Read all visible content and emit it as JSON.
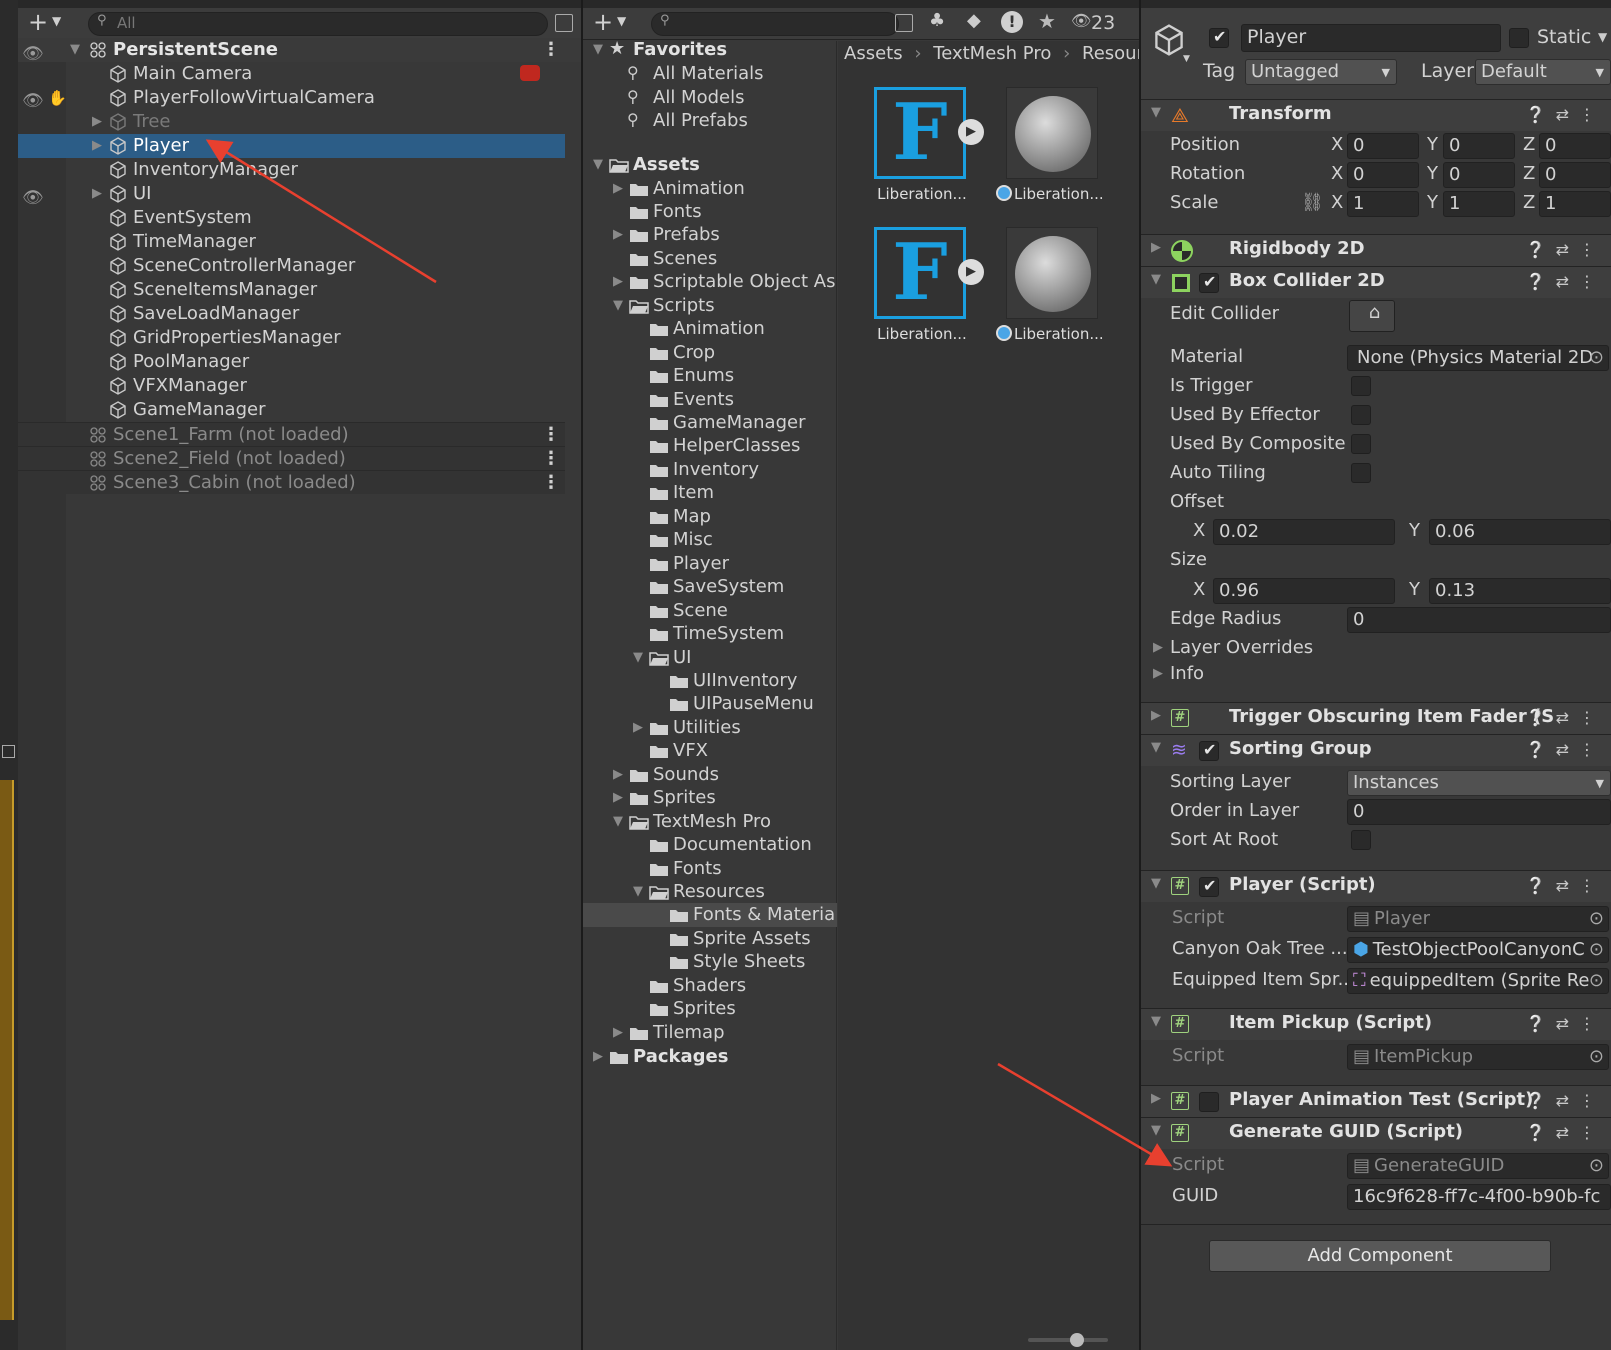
{
  "hierarchy": {
    "search_placeholder": "All",
    "root": "PersistentScene",
    "items": [
      "Main Camera",
      "PlayerFollowVirtualCamera",
      "Tree",
      "Player",
      "InventoryManager",
      "UI",
      "EventSystem",
      "TimeManager",
      "SceneControllerManager",
      "SceneItemsManager",
      "SaveLoadManager",
      "GridPropertiesManager",
      "PoolManager",
      "VFXManager",
      "GameManager"
    ],
    "scenes": [
      "Scene1_Farm (not loaded)",
      "Scene2_Field (not loaded)",
      "Scene3_Cabin (not loaded)"
    ]
  },
  "project": {
    "hidden_count": "23",
    "favorites": {
      "label": "Favorites",
      "items": [
        "All Materials",
        "All Models",
        "All Prefabs"
      ]
    },
    "assets_label": "Assets",
    "tree": [
      {
        "d": 1,
        "t": "Animation",
        "a": "r"
      },
      {
        "d": 1,
        "t": "Fonts",
        "a": ""
      },
      {
        "d": 1,
        "t": "Prefabs",
        "a": "r"
      },
      {
        "d": 1,
        "t": "Scenes",
        "a": ""
      },
      {
        "d": 1,
        "t": "Scriptable Object As",
        "a": "r"
      },
      {
        "d": 1,
        "t": "Scripts",
        "a": "d"
      },
      {
        "d": 2,
        "t": "Animation",
        "a": ""
      },
      {
        "d": 2,
        "t": "Crop",
        "a": ""
      },
      {
        "d": 2,
        "t": "Enums",
        "a": ""
      },
      {
        "d": 2,
        "t": "Events",
        "a": ""
      },
      {
        "d": 2,
        "t": "GameManager",
        "a": ""
      },
      {
        "d": 2,
        "t": "HelperClasses",
        "a": ""
      },
      {
        "d": 2,
        "t": "Inventory",
        "a": ""
      },
      {
        "d": 2,
        "t": "Item",
        "a": ""
      },
      {
        "d": 2,
        "t": "Map",
        "a": ""
      },
      {
        "d": 2,
        "t": "Misc",
        "a": ""
      },
      {
        "d": 2,
        "t": "Player",
        "a": ""
      },
      {
        "d": 2,
        "t": "SaveSystem",
        "a": ""
      },
      {
        "d": 2,
        "t": "Scene",
        "a": ""
      },
      {
        "d": 2,
        "t": "TimeSystem",
        "a": ""
      },
      {
        "d": 2,
        "t": "UI",
        "a": "d"
      },
      {
        "d": 3,
        "t": "UIInventory",
        "a": ""
      },
      {
        "d": 3,
        "t": "UIPauseMenu",
        "a": ""
      },
      {
        "d": 2,
        "t": "Utilities",
        "a": "r"
      },
      {
        "d": 2,
        "t": "VFX",
        "a": ""
      },
      {
        "d": 1,
        "t": "Sounds",
        "a": "r"
      },
      {
        "d": 1,
        "t": "Sprites",
        "a": "r"
      },
      {
        "d": 1,
        "t": "TextMesh Pro",
        "a": "d"
      },
      {
        "d": 2,
        "t": "Documentation",
        "a": ""
      },
      {
        "d": 2,
        "t": "Fonts",
        "a": ""
      },
      {
        "d": 2,
        "t": "Resources",
        "a": "d"
      },
      {
        "d": 3,
        "t": "Fonts & Materia",
        "a": "",
        "sel": true
      },
      {
        "d": 3,
        "t": "Sprite Assets",
        "a": ""
      },
      {
        "d": 3,
        "t": "Style Sheets",
        "a": ""
      },
      {
        "d": 2,
        "t": "Shaders",
        "a": ""
      },
      {
        "d": 2,
        "t": "Sprites",
        "a": ""
      },
      {
        "d": 1,
        "t": "Tilemap",
        "a": "r"
      }
    ],
    "packages_label": "Packages",
    "breadcrumb": [
      "Assets",
      "TextMesh Pro",
      "Resour"
    ],
    "assets": [
      "Liberation...",
      "Liberation...",
      "Liberation...",
      "Liberation..."
    ]
  },
  "inspector": {
    "object_name": "Player",
    "static_label": "Static",
    "tag_label": "Tag",
    "tag_value": "Untagged",
    "layer_label": "Layer",
    "layer_value": "Default",
    "transform": {
      "title": "Transform",
      "rows": [
        {
          "label": "Position",
          "x": "0",
          "y": "0",
          "z": "0"
        },
        {
          "label": "Rotation",
          "x": "0",
          "y": "0",
          "z": "0"
        },
        {
          "label": "Scale",
          "x": "1",
          "y": "1",
          "z": "1"
        }
      ]
    },
    "rigidbody_title": "Rigidbody 2D",
    "box_collider": {
      "title": "Box Collider 2D",
      "edit_collider": "Edit Collider",
      "material_label": "Material",
      "material_value": "None (Physics Material 2D",
      "checks": [
        "Is Trigger",
        "Used By Effector",
        "Used By Composite",
        "Auto Tiling"
      ],
      "offset_label": "Offset",
      "offset_x": "0.02",
      "offset_y": "0.06",
      "size_label": "Size",
      "size_x": "0.96",
      "size_y": "0.13",
      "edge_label": "Edge Radius",
      "edge_value": "0",
      "layer_overrides": "Layer Overrides",
      "info": "Info"
    },
    "trigger_title": "Trigger Obscuring Item Fader (S",
    "sorting_group": {
      "title": "Sorting Group",
      "sorting_layer_label": "Sorting Layer",
      "sorting_layer_value": "Instances",
      "order_label": "Order in Layer",
      "order_value": "0",
      "sort_root_label": "Sort At Root"
    },
    "player_script": {
      "title": "Player (Script)",
      "script_label": "Script",
      "script_value": "Player",
      "canyon_label": "Canyon Oak Tree ...",
      "canyon_value": "TestObjectPoolCanyonC",
      "equipped_label": "Equipped Item Spr...",
      "equipped_value": "equippedItem (Sprite Re"
    },
    "item_pickup": {
      "title": "Item Pickup (Script)",
      "script_label": "Script",
      "script_value": "ItemPickup"
    },
    "anim_test_title": "Player Animation Test (Script)",
    "guid": {
      "title": "Generate GUID (Script)",
      "script_label": "Script",
      "script_value": "GenerateGUID",
      "guid_label": "GUID",
      "guid_value": "16c9f628-ff7c-4f00-b90b-fc"
    },
    "add_component": "Add Component"
  },
  "colors": {
    "selection": "#2c5d87",
    "annotation_arrow": "#e8402f",
    "panel": "#383838"
  }
}
